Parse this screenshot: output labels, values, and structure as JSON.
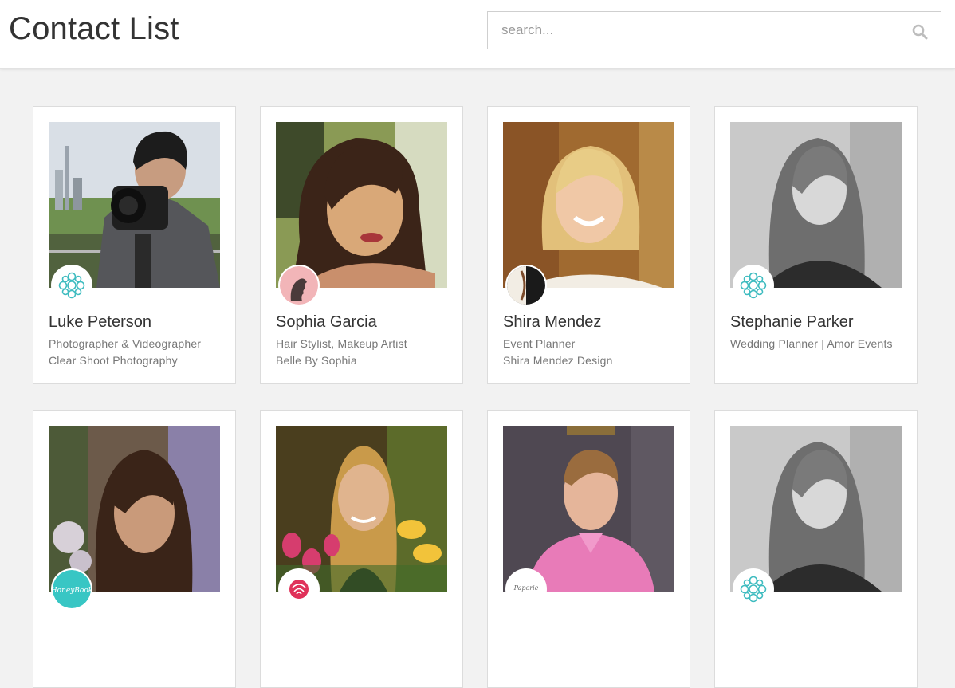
{
  "header": {
    "title": "Contact List"
  },
  "search": {
    "placeholder": "search...",
    "value": "",
    "icon": "search-icon"
  },
  "contacts": [
    {
      "name": "Luke Peterson",
      "role": "Photographer & Videographer",
      "company": "Clear Shoot Photography",
      "badge": "mandala-logo"
    },
    {
      "name": "Sophia Garcia",
      "role": "Hair Stylist, Makeup Artist",
      "company": "Belle By Sophia",
      "badge": "silhouette-logo"
    },
    {
      "name": "Shira Mendez",
      "role": "Event Planner",
      "company": "Shira Mendez Design",
      "badge": "split-logo"
    },
    {
      "name": "Stephanie Parker",
      "role": "Wedding Planner | Amor Events",
      "company": "",
      "badge": "mandala-logo"
    },
    {
      "name": "",
      "role": "",
      "company": "",
      "badge": "honeybook-logo",
      "badge_text": "HoneyBook"
    },
    {
      "name": "",
      "role": "",
      "company": "",
      "badge": "rose-logo"
    },
    {
      "name": "",
      "role": "",
      "company": "",
      "badge": "paperie-logo",
      "badge_text": "Paperie"
    },
    {
      "name": "",
      "role": "",
      "company": "",
      "badge": "mandala-logo"
    }
  ]
}
